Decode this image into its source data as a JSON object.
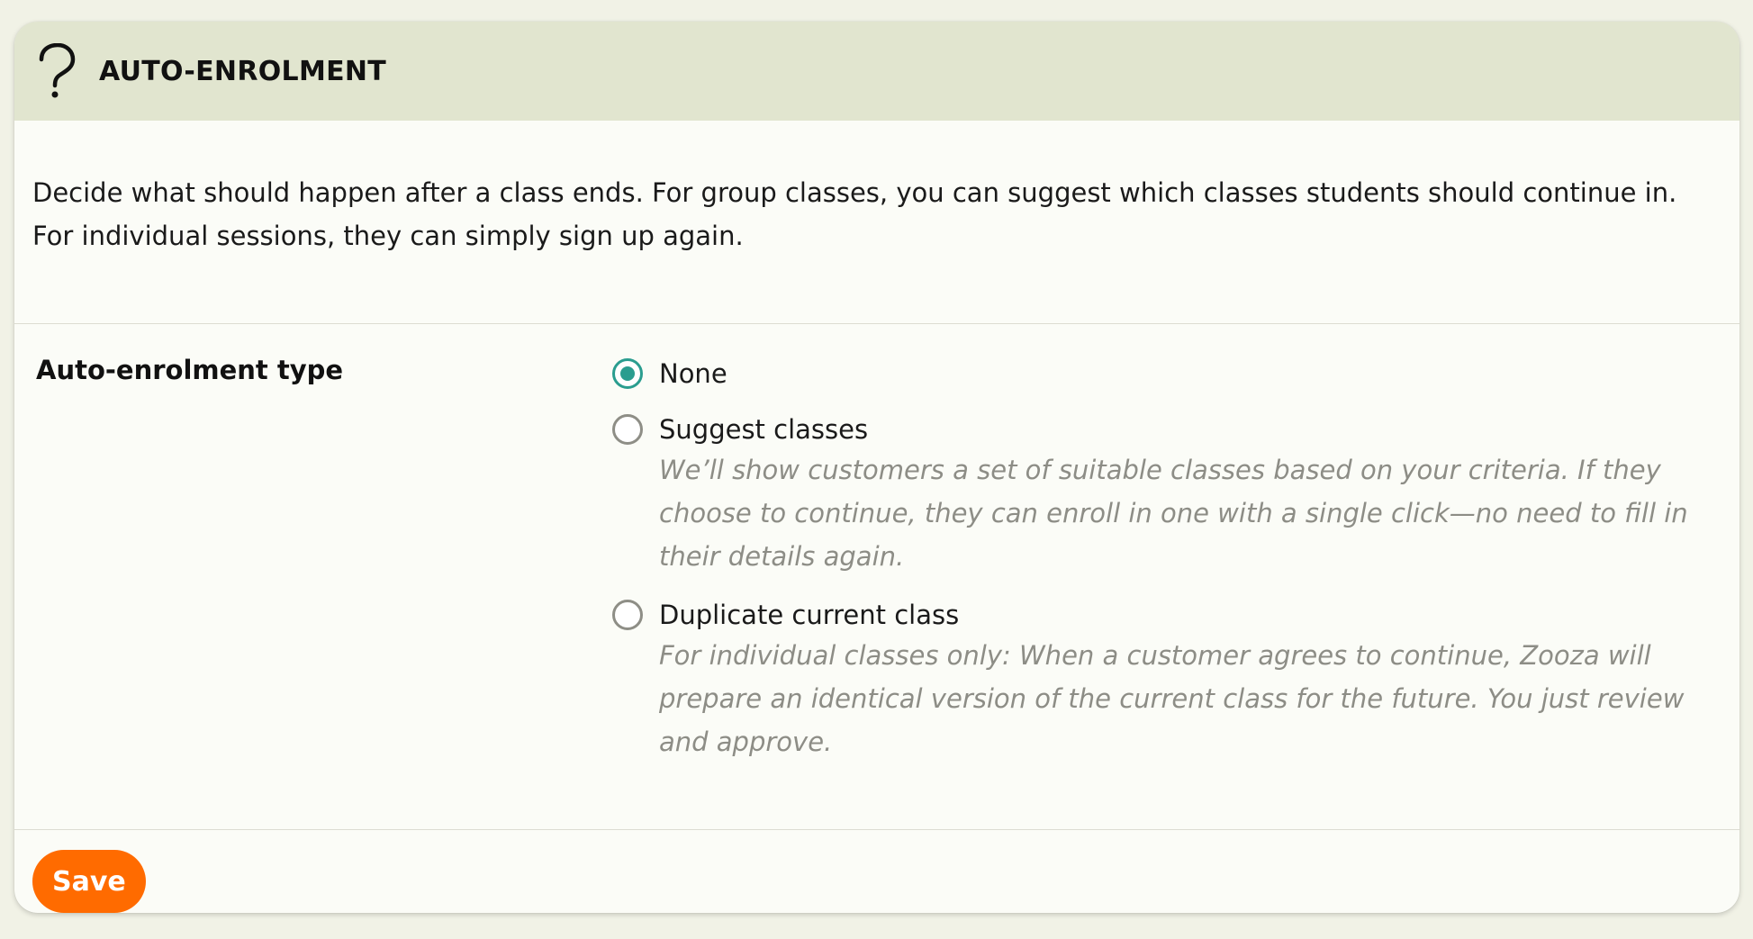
{
  "header": {
    "title": "AUTO-ENROLMENT",
    "icon": "question-mark-icon"
  },
  "intro": {
    "text": "Decide what should happen after a class ends. For group classes, you can suggest which classes students should continue in. For individual sessions, they can simply sign up again."
  },
  "form": {
    "field_label": "Auto-enrolment type",
    "selected": "None",
    "options": [
      {
        "label": "None",
        "checked": true,
        "description": ""
      },
      {
        "label": "Suggest classes",
        "checked": false,
        "description": "We’ll show customers a set of suitable classes based on your criteria. If they choose to continue, they can enroll in one with a single click—no need to fill in their details again."
      },
      {
        "label": "Duplicate current class",
        "checked": false,
        "description": "For individual classes only: When a customer agrees to continue, Zooza will prepare an identical version of the current class for the future. You just review and approve."
      }
    ]
  },
  "footer": {
    "save_label": "Save"
  },
  "colors": {
    "accent": "#2a9d8f",
    "save_button": "#ff6b00",
    "header_bg": "#e1e5cf"
  }
}
